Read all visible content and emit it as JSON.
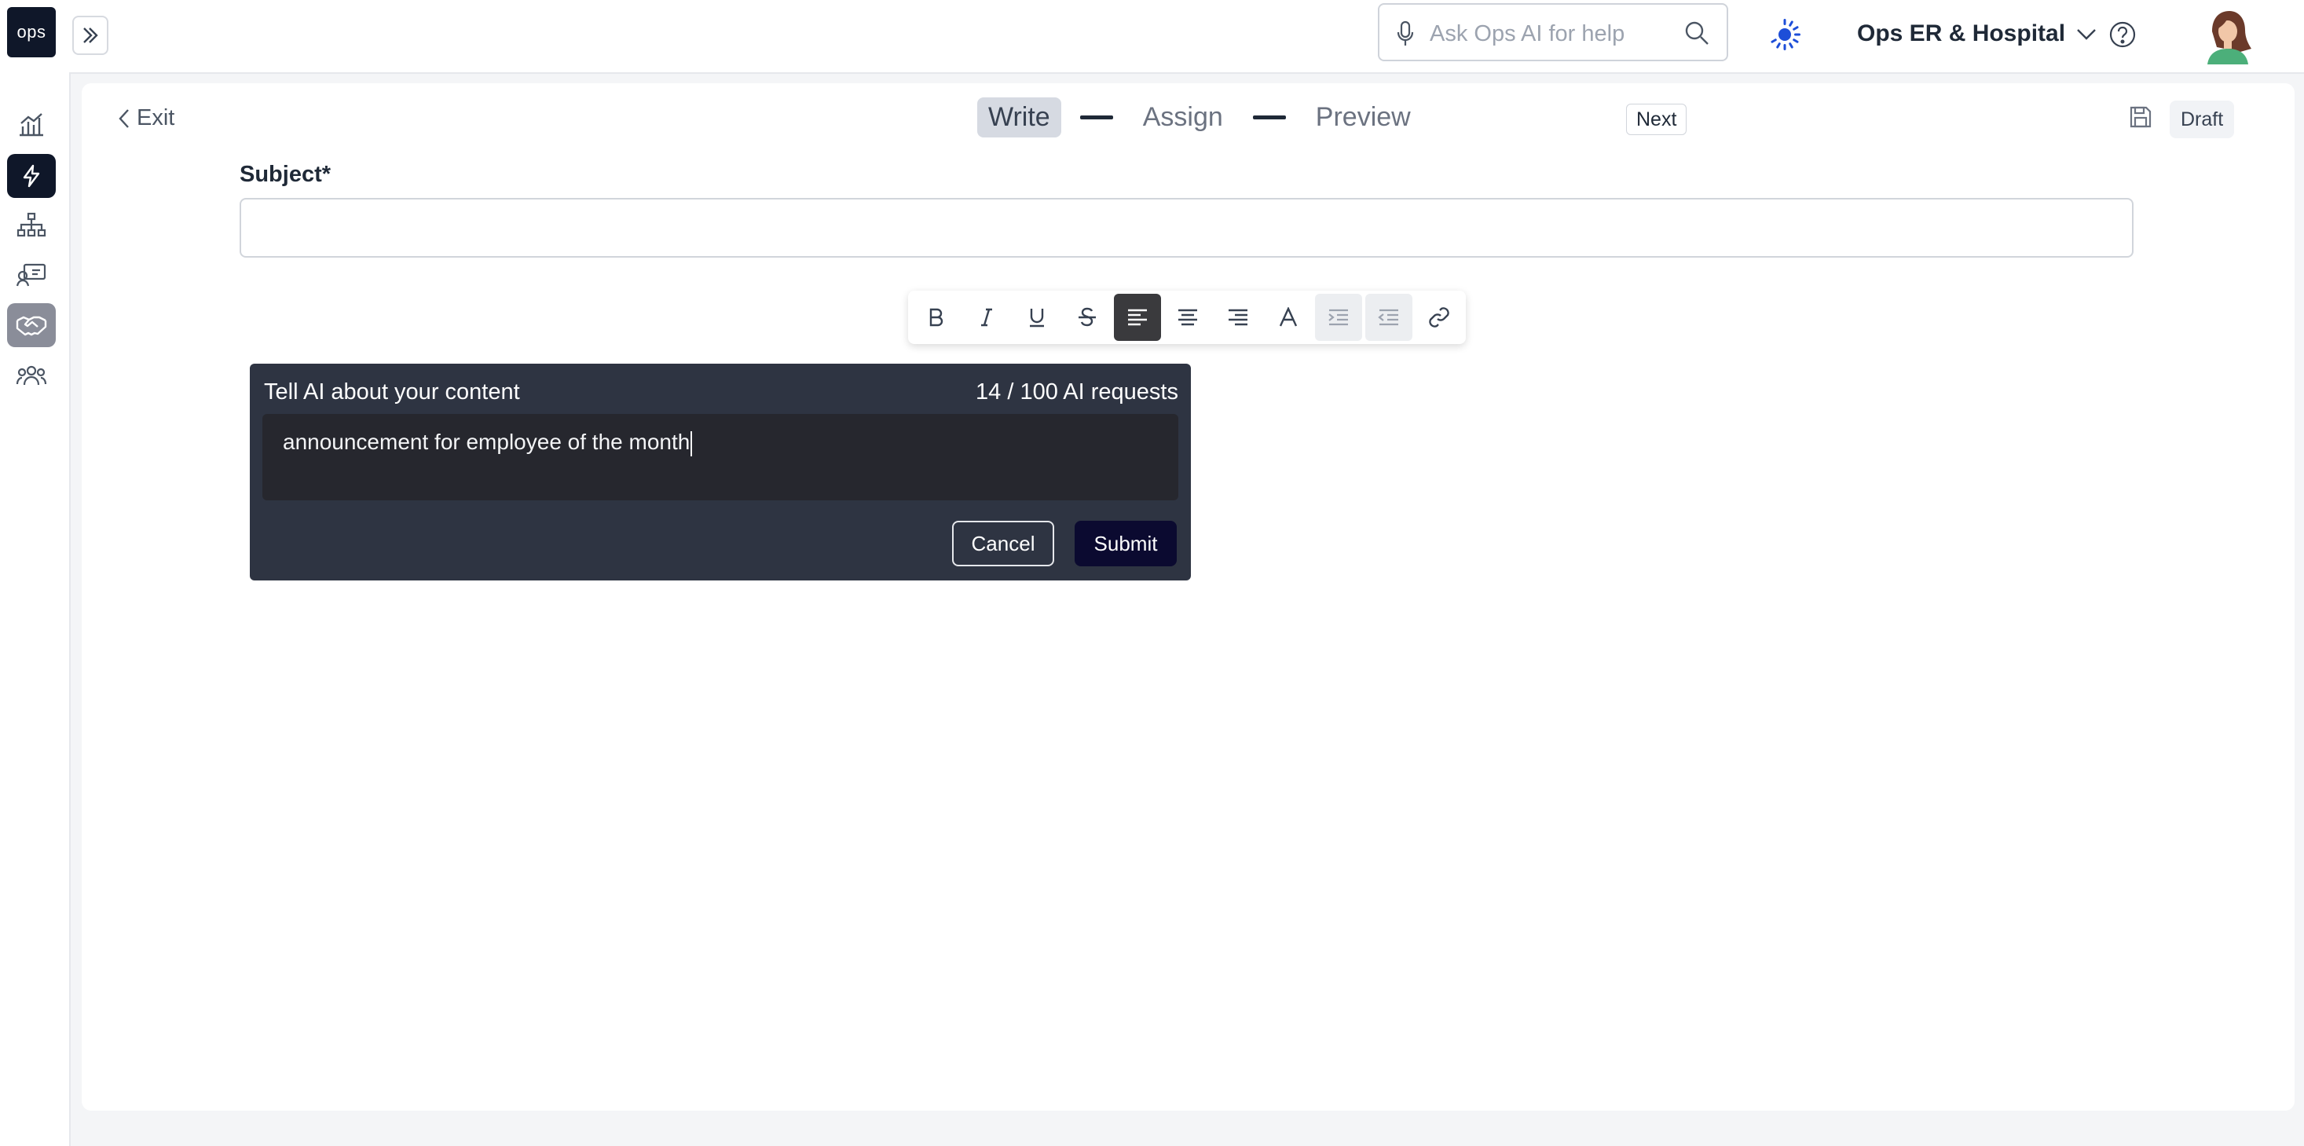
{
  "app": {
    "logo_text": "ops"
  },
  "sidebar": {
    "items": [
      {
        "icon": "analytics-chart-icon",
        "active": false
      },
      {
        "icon": "lightning-bolt-icon",
        "active": true
      },
      {
        "icon": "org-chart-icon",
        "active": false
      },
      {
        "icon": "id-card-icon",
        "active": false
      },
      {
        "icon": "handshake-icon",
        "selected": true
      },
      {
        "icon": "people-group-icon",
        "active": false
      }
    ]
  },
  "header": {
    "search_placeholder": "Ask Ops AI for help",
    "org_name": "Ops ER & Hospital"
  },
  "editor": {
    "exit_label": "Exit",
    "steps": [
      "Write",
      "Assign",
      "Preview"
    ],
    "current_step": "Write",
    "next_label": "Next",
    "status_label": "Draft",
    "subject_label": "Subject*",
    "subject_value": ""
  },
  "toolbar": {
    "buttons": [
      "bold",
      "italic",
      "underline",
      "strikethrough",
      "align-left",
      "align-center",
      "align-right",
      "text-color",
      "indent",
      "outdent",
      "link"
    ],
    "active": "align-left"
  },
  "ai_panel": {
    "title": "Tell AI about your content",
    "usage": "14 / 100 AI requests",
    "prompt_text": "announcement for employee of the month",
    "cancel_label": "Cancel",
    "submit_label": "Submit"
  },
  "colors": {
    "brand_dark": "#0f1729",
    "ai_panel_bg": "#2e3442",
    "submit_bg": "#0b0a30",
    "loader_blue": "#1d4ed8"
  }
}
